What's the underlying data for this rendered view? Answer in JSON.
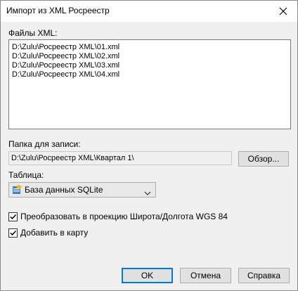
{
  "window": {
    "title": "Импорт из XML Росреестр",
    "close_icon": "close-icon"
  },
  "files": {
    "label": "Файлы XML:",
    "items": [
      "D:\\Zulu\\Росреестр XML\\01.xml",
      "D:\\Zulu\\Росреестр XML\\02.xml",
      "D:\\Zulu\\Росреестр XML\\03.xml",
      "D:\\Zulu\\Росреестр XML\\04.xml"
    ]
  },
  "folder": {
    "label": "Папка для записи:",
    "value": "D:\\Zulu\\Росреестр XML\\Квартал 1\\",
    "browse_label": "Обзор..."
  },
  "table": {
    "label": "Таблица:",
    "selected": "База данных SQLite",
    "icon": "database-icon"
  },
  "options": {
    "convert": {
      "label": "Преобразовать в  проекцию Широта/Долгота WGS 84",
      "checked": true
    },
    "add_to_map": {
      "label": "Добавить в карту",
      "checked": true
    }
  },
  "buttons": {
    "ok": "OK",
    "cancel": "Отмена",
    "help": "Справка"
  },
  "colors": {
    "window_bg": "#f0f0f0",
    "titlebar_bg": "#ffffff",
    "default_button_border": "#0078d7"
  }
}
